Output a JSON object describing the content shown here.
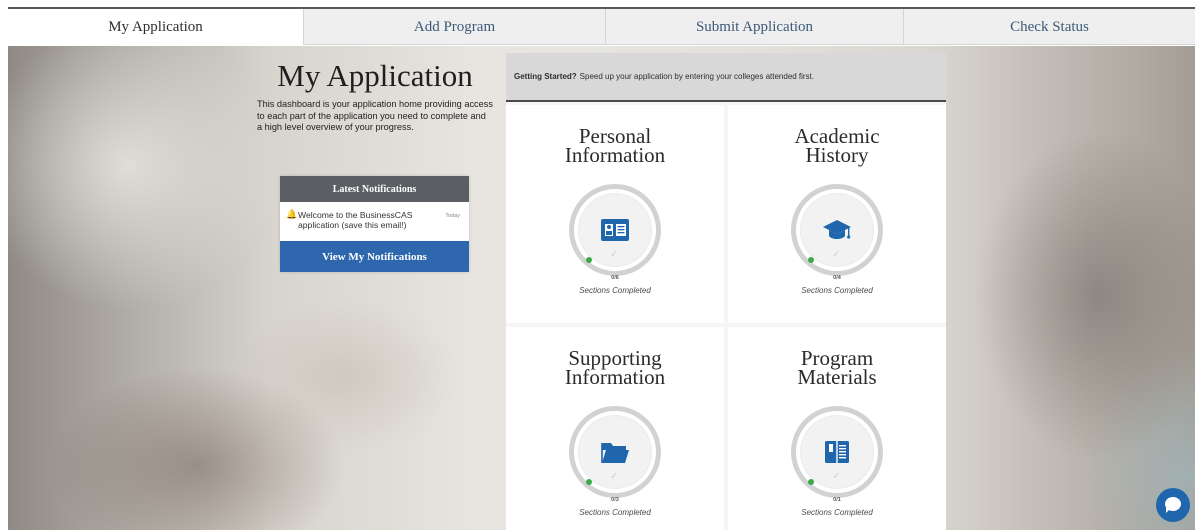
{
  "tabs": [
    {
      "label": "My Application"
    },
    {
      "label": "Add Program"
    },
    {
      "label": "Submit Application"
    },
    {
      "label": "Check Status"
    }
  ],
  "intro": {
    "title": "My Application",
    "description": "This dashboard is your application home providing access to each part of the application you need to complete and a high level overview of your progress."
  },
  "notifications": {
    "header": "Latest Notifications",
    "items": [
      {
        "icon": "bell-icon",
        "text": "Welcome to the BusinessCAS application (save this email!)",
        "time": "Today"
      }
    ],
    "button_label": "View My Notifications"
  },
  "getting_started": {
    "bold": "Getting Started?",
    "text": "Speed up your application by entering your colleges attended first."
  },
  "tiles": [
    {
      "title_line1": "Personal",
      "title_line2": "Information",
      "icon": "id-card-icon",
      "count": "0/6",
      "status": "Sections Completed",
      "progress": 0.0
    },
    {
      "title_line1": "Academic",
      "title_line2": "History",
      "icon": "graduation-cap-icon",
      "count": "0/4",
      "status": "Sections Completed",
      "progress": 0.0
    },
    {
      "title_line1": "Supporting",
      "title_line2": "Information",
      "icon": "folder-icon",
      "count": "0/3",
      "status": "Sections Completed",
      "progress": 0.0
    },
    {
      "title_line1": "Program",
      "title_line2": "Materials",
      "icon": "book-icon",
      "count": "0/1",
      "status": "Sections Completed",
      "progress": 0.0
    }
  ],
  "colors": {
    "accent_blue": "#2f67ae",
    "icon_blue": "#1f66ad",
    "progress_green": "#3fa94a",
    "notif_header": "#5b5f64"
  },
  "chat": {
    "icon": "chat-bubble-icon"
  }
}
